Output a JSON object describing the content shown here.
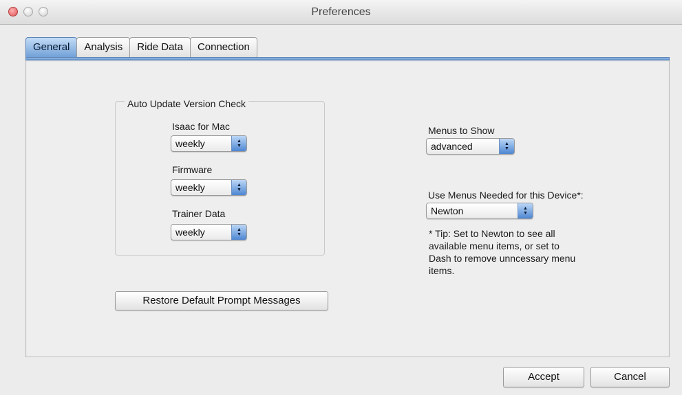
{
  "window": {
    "title": "Preferences"
  },
  "tabs": [
    {
      "label": "General",
      "active": true
    },
    {
      "label": "Analysis",
      "active": false
    },
    {
      "label": "Ride Data",
      "active": false
    },
    {
      "label": "Connection",
      "active": false
    }
  ],
  "auto_update": {
    "group_title": "Auto Update Version Check",
    "isaac_label": "Isaac for Mac",
    "isaac_value": "weekly",
    "firmware_label": "Firmware",
    "firmware_value": "weekly",
    "trainer_label": "Trainer Data",
    "trainer_value": "weekly"
  },
  "restore_button": "Restore Default Prompt Messages",
  "menus_to_show": {
    "label": "Menus to Show",
    "value": "advanced"
  },
  "device_menus": {
    "label": "Use Menus Needed for this Device*:",
    "value": "Newton",
    "tip": "* Tip: Set to Newton to see all available menu items, or set to Dash to remove unncessary menu items."
  },
  "footer": {
    "accept": "Accept",
    "cancel": "Cancel"
  },
  "colors": {
    "accent": "#5f8fc8",
    "window_bg": "#ececec",
    "panel_bg": "#eeeeee"
  }
}
